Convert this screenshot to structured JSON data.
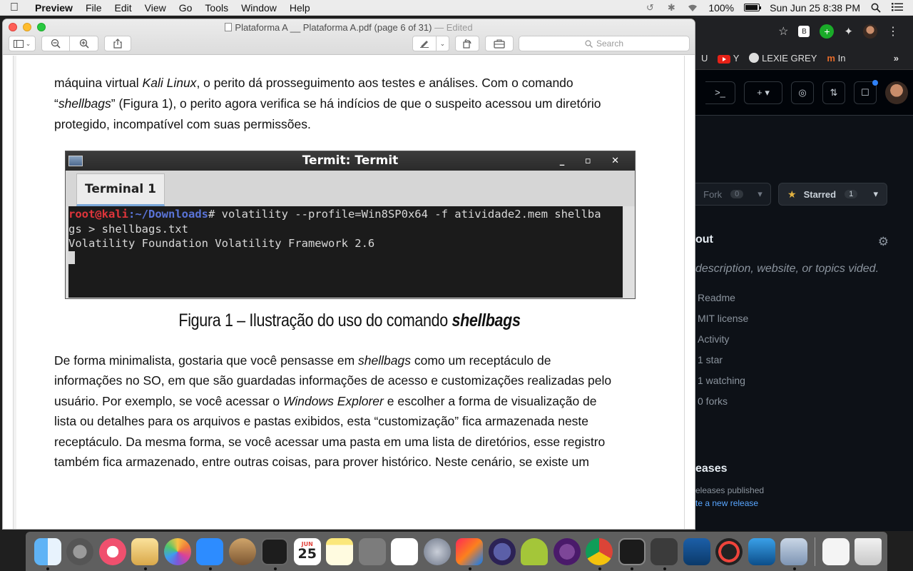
{
  "menubar": {
    "app_name": "Preview",
    "items": [
      "File",
      "Edit",
      "View",
      "Go",
      "Tools",
      "Window",
      "Help"
    ],
    "battery": "100%",
    "clock": "Sun Jun 25  8:38 PM"
  },
  "window": {
    "title": "Plataforma A __ Plataforma A.pdf (page 6 of 31)",
    "edited": "— Edited",
    "search_placeholder": "Search"
  },
  "document": {
    "para_top_1": "máquina virtual Kali Linux, o perito dá prosseguimento aos testes e análises. Com o comando",
    "para_top_2a": "“",
    "para_top_2_em": "shellbags",
    "para_top_2b": "” (Figura 1), o perito agora verifica se há indícios de que o suspeito acessou um diretório",
    "para_top_3": "protegido, incompatível com suas permissões.",
    "figure": {
      "window_title": "Termit: Termit",
      "tab_label": "Terminal 1",
      "prompt_user": "root@kali",
      "prompt_path": ":~/Downloads",
      "command_1": "# volatility --profile=Win8SP0x64 -f atividade2.mem shellba",
      "command_2": "gs > shellbags.txt",
      "output": "Volatility Foundation Volatility Framework 2.6"
    },
    "caption_prefix": "Figura 1 – Ilustração do uso do comando ",
    "caption_em": "shellbags",
    "body_lines": [
      "De forma minimalista, gostaria que você pensasse em shellbags como um receptáculo de",
      "informações no SO, em que são guardadas informações de acesso e customizações realizadas pelo",
      "usuário. Por exemplo, se você acessar o Windows Explorer e escolher a forma de visualização de",
      "lista ou detalhes para os arquivos e pastas exibidos, esta “customização” fica armazenada neste",
      "receptáculo. Da mesma forma, se você acessar uma pasta em uma lista de diretórios, esse registro",
      "também fica armazenado, entre outras coisas, para prover histórico. Neste cenário, se existe um"
    ]
  },
  "browser": {
    "bookmarks": [
      "U",
      "Y",
      "LEXIE GREY",
      "In"
    ],
    "fork_label": "Fork",
    "fork_count": "0",
    "star_label": "Starred",
    "star_count": "1",
    "about_title": "out",
    "about_desc": "description, website, or topics vided.",
    "stats": [
      "Readme",
      "MIT license",
      "Activity",
      "1 star",
      "1 watching",
      "0 forks"
    ],
    "releases_title": "eases",
    "releases_none": "eleases published",
    "releases_link": "te a new release"
  },
  "dock": {
    "calendar_month": "JUN",
    "calendar_day": "25",
    "apps": [
      "finder-icon",
      "system-preferences-icon",
      "itunes-icon",
      "preview-icon",
      "photos-icon",
      "zoom-icon",
      "xquartz-icon",
      "activity-monitor-icon",
      "calendar-icon",
      "notes-icon",
      "calculator-icon",
      "reminders-icon",
      "launchpad-icon",
      "intellij-icon",
      "eclipse-icon",
      "android-studio-icon",
      "tor-icon",
      "chrome-icon",
      "terminal-icon",
      "sublime-icon",
      "virtualbox-icon",
      "anydesk-icon",
      "remote-desktop-icon",
      "preview-image-icon",
      "documents-icon",
      "trash-icon"
    ]
  }
}
